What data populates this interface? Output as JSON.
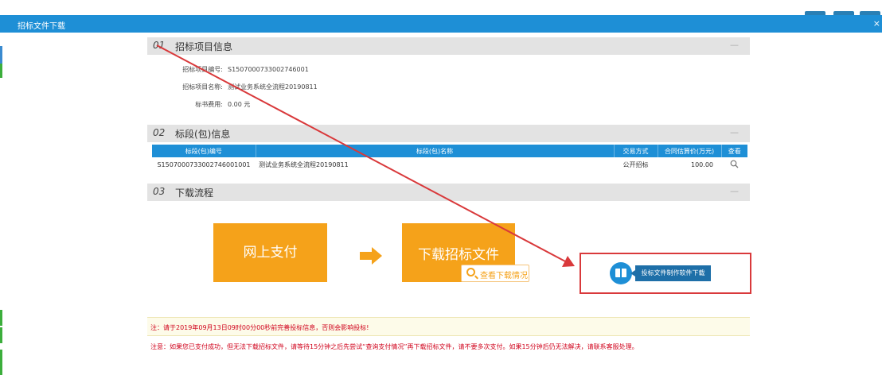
{
  "window": {
    "title": "招标文件下载",
    "close_glyph": "×"
  },
  "sections": [
    {
      "num": "01",
      "label": "招标项目信息",
      "collapse": "—"
    },
    {
      "num": "02",
      "label": "标段(包)信息",
      "collapse": "—"
    },
    {
      "num": "03",
      "label": "下载流程",
      "collapse": "—"
    }
  ],
  "project_info": [
    {
      "key": "招标项目编号:",
      "value": "S1507000733002746001"
    },
    {
      "key": "招标项目名称:",
      "value": "测试业务系统全流程20190811"
    },
    {
      "key": "标书费用:",
      "value": "0.00 元"
    }
  ],
  "table": {
    "headers": [
      "标段(包)编号",
      "标段(包)名称",
      "交易方式",
      "合同估算价(万元)",
      "查看"
    ],
    "rows": [
      {
        "code": "S1507000733002746001001",
        "name": "测试业务系统全流程20190811",
        "method": "公开招标",
        "price": "100.00",
        "view_icon": "search-icon"
      }
    ]
  },
  "flow": {
    "step1": "网上支付",
    "step2": "下载招标文件",
    "view_status": "查看下载情况",
    "software_download": "投标文件制作软件下载"
  },
  "notes": {
    "deadline": "注：请于2019年09月13日09时00分00秒前完善投标信息，否则会影响投标!",
    "payment": "注意：如果您已支付成功，但无法下载招标文件，请等待15分钟之后先尝试“查询支付情况”再下载招标文件，请不要多次支付。如果15分钟后仍无法解决，请联系客服处理。"
  },
  "colors": {
    "accent": "#1e8fd6",
    "flow": "#f5a21a",
    "annotation": "#d9393b",
    "note": "#d0021b"
  }
}
